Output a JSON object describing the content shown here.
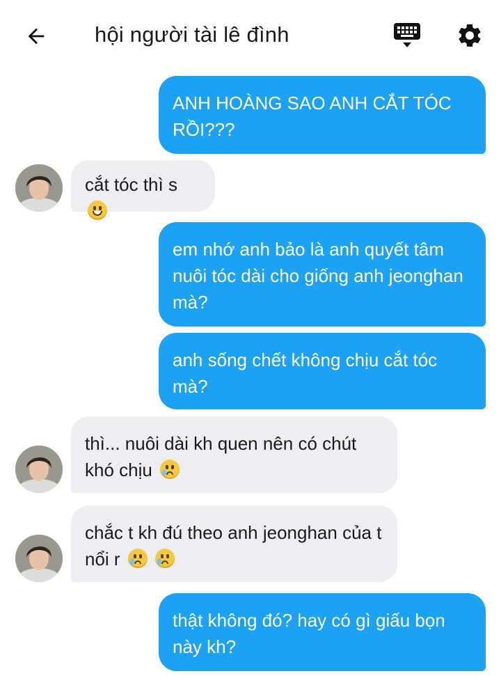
{
  "header": {
    "title": "hội người tài lê đình",
    "back_icon": "arrow-left-icon",
    "keyboard_icon": "keyboard-icon",
    "settings_icon": "gear-icon"
  },
  "messages": [
    {
      "side": "sent",
      "text": "ANH HOÀNG SAO ANH CẮT TÓC RỒI???"
    },
    {
      "side": "received",
      "text": "cắt tóc thì s",
      "emoji": [
        "grinning-face"
      ]
    },
    {
      "side": "sent",
      "text": "em nhớ anh bảo là anh quyết tâm nuôi tóc dài cho giống anh jeonghan mà?"
    },
    {
      "side": "sent",
      "text": "anh sống chết không chịu cắt tóc mà?"
    },
    {
      "side": "received",
      "text": "thì... nuôi dài kh quen nên có chút khó chịu",
      "emoji": [
        "crying-face"
      ]
    },
    {
      "side": "received",
      "text": "chắc t kh đú theo anh jeonghan của t nổi r",
      "emoji": [
        "crying-face",
        "crying-face"
      ]
    },
    {
      "side": "sent",
      "text": "thật không đó? hay có gì giấu bọn này kh?"
    }
  ],
  "colors": {
    "sent_bubble": "#1da1f2",
    "received_bubble": "#eceef1",
    "background": "#ffffff"
  }
}
